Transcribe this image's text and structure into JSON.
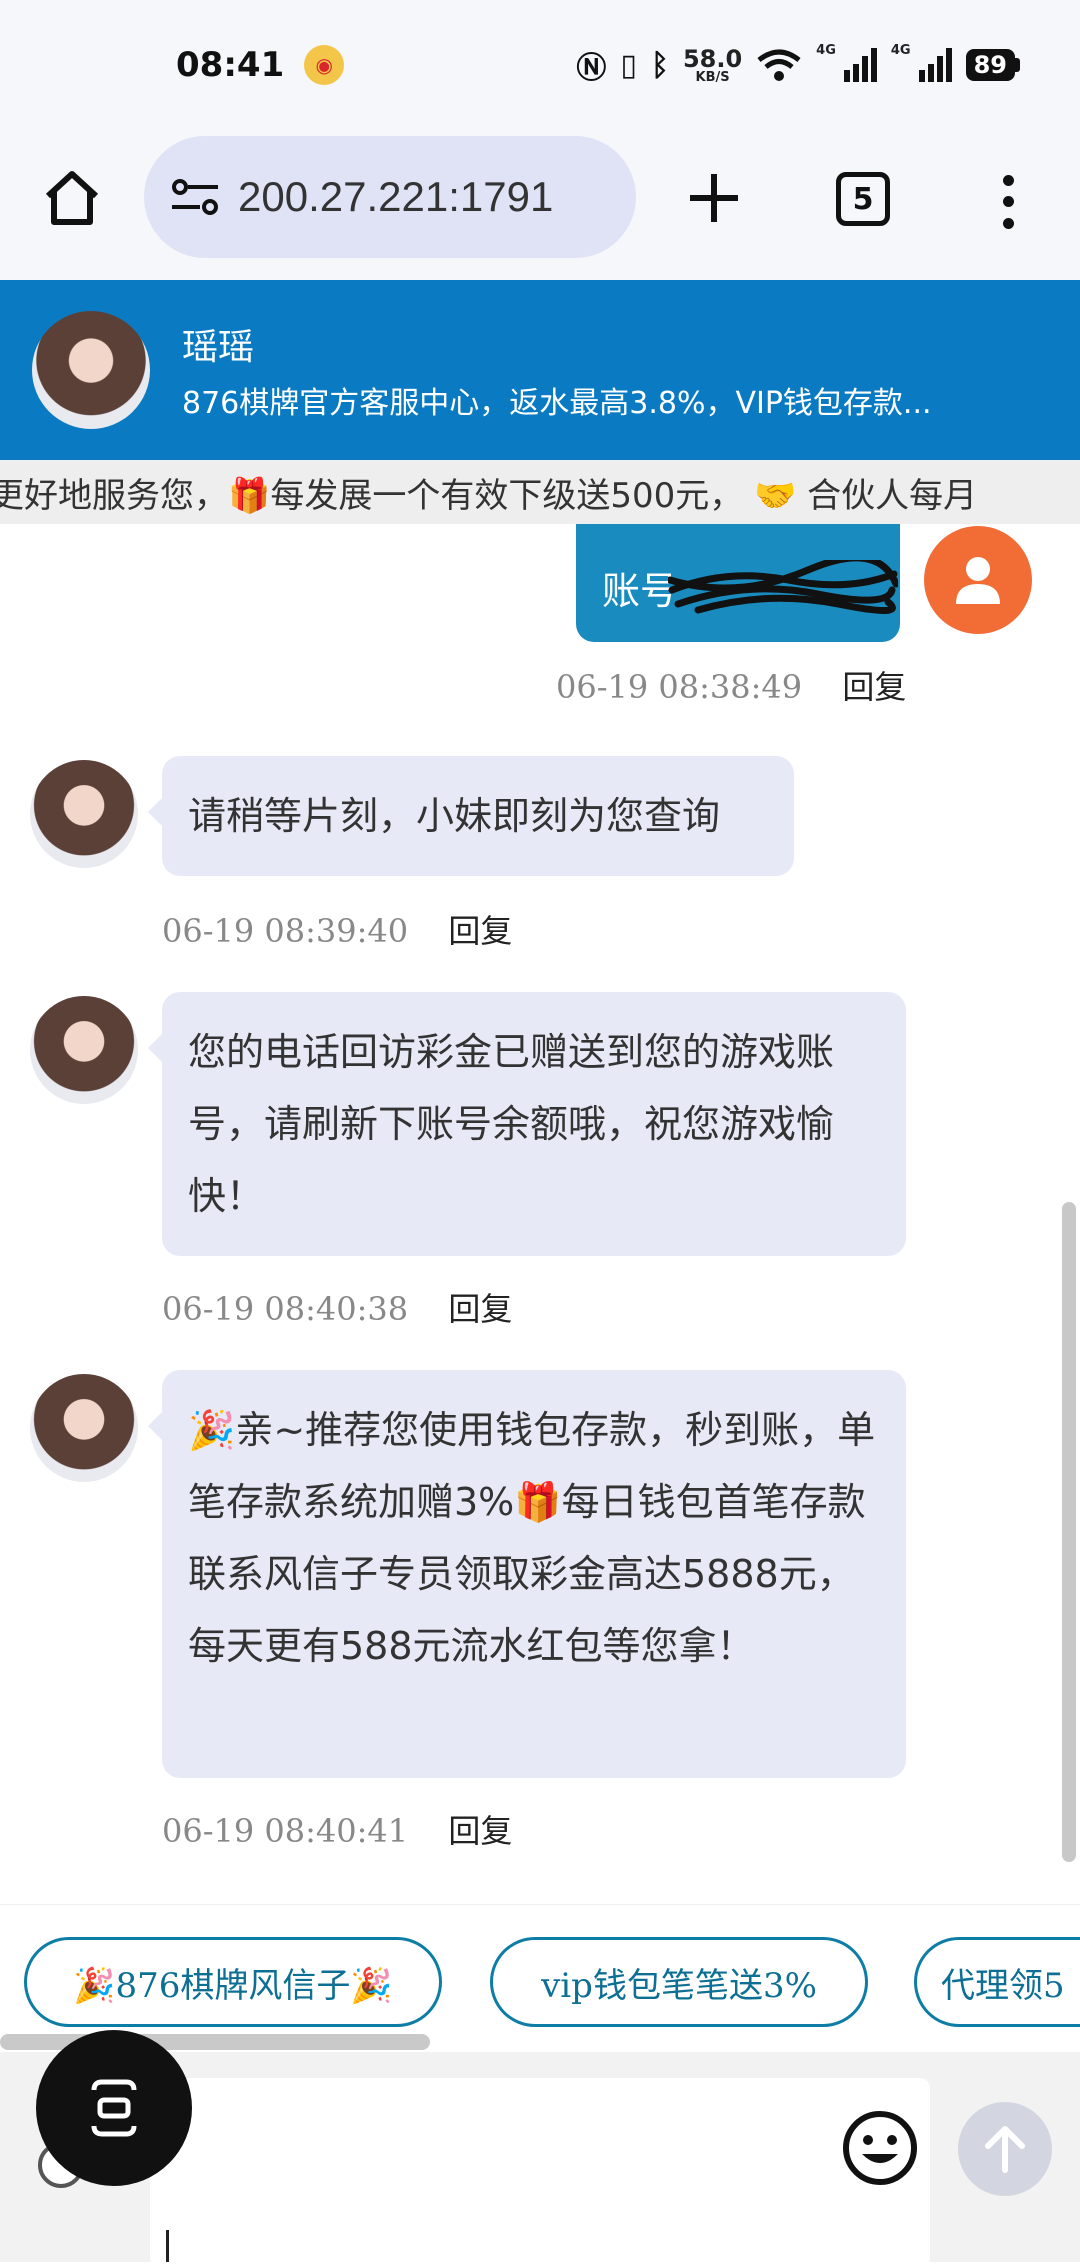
{
  "status_bar": {
    "time": "08:41",
    "speed_value": "58.0",
    "speed_unit": "KB/S",
    "net1": "4G",
    "net2": "4G",
    "battery": "89"
  },
  "browser": {
    "url": "200.27.221:1791",
    "tab_count": "5"
  },
  "agent": {
    "name": "瑶瑶",
    "description": "876棋牌官方客服中心，返水最高3.8%，VIP钱包存款..."
  },
  "marquee": {
    "text": "更好地服务您，🎁每发展一个有效下级送500元， 🤝 合伙人每月"
  },
  "user_message": {
    "label": "账号",
    "time": "06-19 08:38:49",
    "reply": "回复"
  },
  "messages": [
    {
      "text": "请稍等片刻，小妹即刻为您查询",
      "time": "06-19 08:39:40",
      "reply": "回复"
    },
    {
      "text": "您的电话回访彩金已赠送到您的游戏账号，请刷新下账号余额哦，祝您游戏愉快！",
      "time": "06-19 08:40:38",
      "reply": "回复"
    },
    {
      "text": "🎉亲~推荐您使用钱包存款，秒到账，单笔存款系统加赠3%🎁每日钱包首笔存款联系风信子专员领取彩金高达5888元，每天更有588元流水红包等您拿！",
      "time": "06-19 08:40:41",
      "reply": "回复"
    }
  ],
  "quick_replies": [
    "🎉876棋牌风信子🎉",
    "vip钱包笔笔送3%",
    "代理领5"
  ],
  "colors": {
    "header_blue": "#0a7bc2",
    "user_bubble": "#1a8bbf",
    "agent_bubble": "#e7e9f6",
    "user_avatar": "#f26d36",
    "chip_border": "#0e7da5"
  }
}
